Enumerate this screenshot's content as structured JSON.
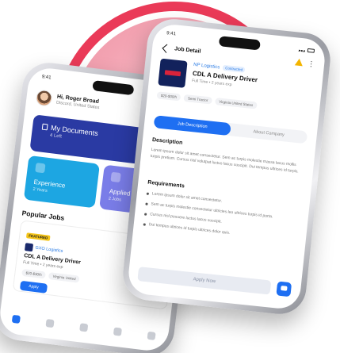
{
  "colors": {
    "accent": "#1e6ff2",
    "ring": "#ea3a58",
    "docs": "#2a3aa3",
    "experience": "#1da6e2",
    "applied": "#7a7de8",
    "featured": "#f5c518"
  },
  "left_phone": {
    "time": "9:41",
    "greeting": "Hi, Roger Broad",
    "location": "Discord, United States",
    "documents": {
      "title": "My Documents",
      "subtitle": "4 Left"
    },
    "experience": {
      "title": "Experience",
      "subtitle": "2 Years"
    },
    "applied": {
      "title": "Applied Jobs",
      "subtitle": "2 Jobs"
    },
    "section": "Popular Jobs",
    "job": {
      "badge": "FEATURED",
      "company": "GXO Logistics",
      "title": "CDL A Delivery Driver",
      "meta": "Full Time • 2 years exp",
      "salary": "$20-$30/h",
      "location": "Virginia United",
      "apply": "Apply"
    },
    "nav_icons": [
      "home-icon",
      "people-icon",
      "bell-icon",
      "chat-icon",
      "gear-icon"
    ]
  },
  "right_phone": {
    "time": "9:41",
    "title": "Job Detail",
    "company": "NP Logistics",
    "contracted": "Contracted",
    "job_title": "CDL A Delivery Driver",
    "meta": "Full Time • 2 years exp",
    "chips": [
      "$20-$30/h",
      "Semi Tractor",
      "Virginia United States"
    ],
    "tabs": [
      "Job Description",
      "About Company"
    ],
    "description_heading": "Description",
    "description": "Lorem ipsum dolor sit amet consectetur. Sem ac turpis molestie massa lacus mollis turpis pretium. Cursus nisl volutpat luctus lacus suscipit. Dui tempus ultrices id turpis.",
    "requirements_heading": "Requirements",
    "requirements": [
      "Lorem ipsum dolor sit amet consectetur.",
      "Sem ac turpis molestie consectetur ultricies leo ultrices turpis id porta.",
      "Cursus nisl posuere luctus lacus suscipit.",
      "Dui tempus ultrices id turpis ultrices dolor quis."
    ],
    "apply": "Apply Now"
  }
}
